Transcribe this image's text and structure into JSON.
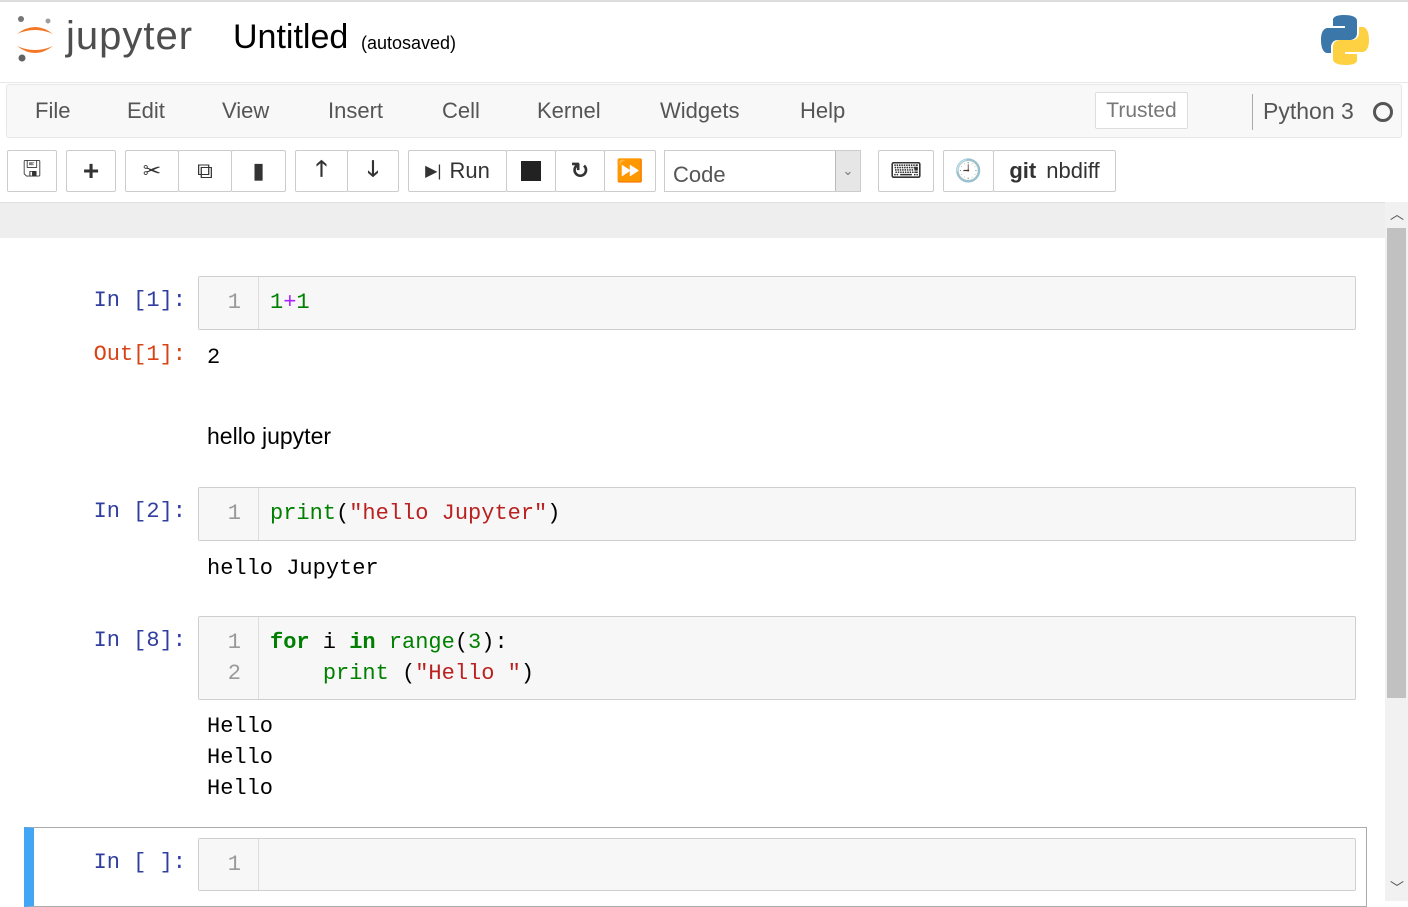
{
  "header": {
    "logo_text": "jupyter",
    "title": "Untitled",
    "autosave_status": "(autosaved)"
  },
  "menu": {
    "items": [
      "File",
      "Edit",
      "View",
      "Insert",
      "Cell",
      "Kernel",
      "Widgets",
      "Help"
    ],
    "trusted": "Trusted",
    "kernel": "Python 3"
  },
  "toolbar": {
    "run_label": "Run",
    "cell_type": "Code",
    "git_label": "git",
    "nbdiff_label": "nbdiff"
  },
  "cells": [
    {
      "prompt": "In [1]:",
      "line_numbers": [
        "1"
      ],
      "out_prompt": "Out[1]:",
      "output": "2"
    },
    {
      "markdown": "hello jupyter"
    },
    {
      "prompt": "In [2]:",
      "line_numbers": [
        "1"
      ],
      "output": "hello Jupyter"
    },
    {
      "prompt": "In [8]:",
      "line_numbers": [
        "1",
        "2"
      ],
      "output": [
        "Hello",
        "Hello",
        "Hello"
      ]
    },
    {
      "prompt": "In [ ]:",
      "line_numbers": [
        "1"
      ]
    }
  ],
  "code": {
    "c1": {
      "a": "1",
      "op": "+",
      "b": "1"
    },
    "c2": {
      "fn": "print",
      "p1": "(",
      "s": "\"hello Jupyter\"",
      "p2": ")"
    },
    "c3": {
      "for": "for",
      "i": " i ",
      "in": "in",
      "range": "range",
      "args": "(",
      "n": "3",
      "close": "):",
      "indent": "    ",
      "print": "print",
      "sp": " (",
      "s": "\"Hello \"",
      "end": ")"
    }
  },
  "colors": {
    "accent": "#42a5f5",
    "prompt_in": "#303f9f",
    "prompt_out": "#d84315"
  }
}
